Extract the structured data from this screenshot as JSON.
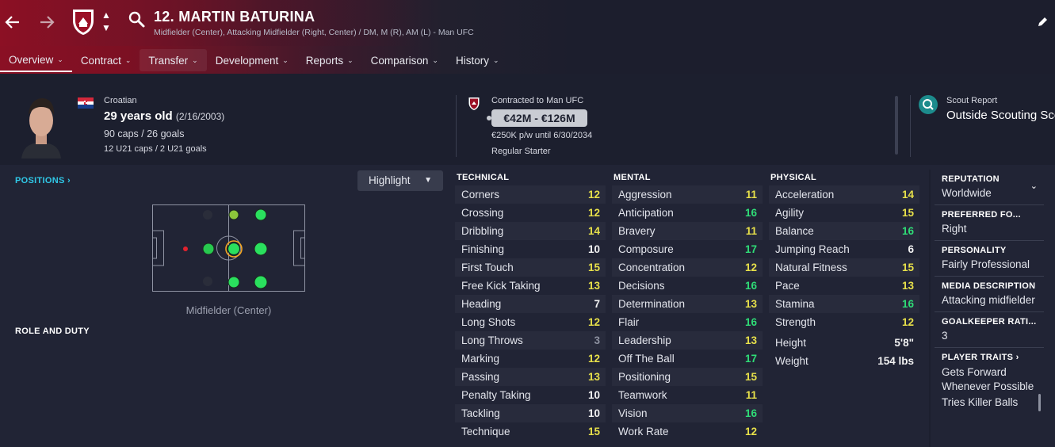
{
  "header": {
    "player_name": "12. MARTIN BATURINA",
    "positions_line": "Midfielder (Center), Attacking Midfielder (Right, Center) / DM, M (R), AM (L) - Man UFC",
    "back_icon": "arrow-left-icon",
    "forward_icon": "arrow-right-icon",
    "search_icon": "search-icon",
    "edit_icon": "pencil-icon",
    "brand_color": "#8a1024"
  },
  "tabs": [
    {
      "label": "Overview"
    },
    {
      "label": "Contract"
    },
    {
      "label": "Transfer"
    },
    {
      "label": "Development"
    },
    {
      "label": "Reports"
    },
    {
      "label": "Comparison"
    },
    {
      "label": "History"
    }
  ],
  "profile": {
    "nationality": "Croatian",
    "age": "29 years old",
    "dob": "(2/16/2003)",
    "caps": "90 caps / 26 goals",
    "u21": "12 U21 caps / 2 U21 goals"
  },
  "contract": {
    "contracted_to": "Contracted to Man UFC",
    "value": "€42M - €126M",
    "wage": "€250K p/w until 6/30/2034",
    "status": "Regular Starter"
  },
  "scout": {
    "label": "Scout Report",
    "value": "Outside Scouting Sco"
  },
  "positions_panel": {
    "title": "POSITIONS ›",
    "highlight_label": "Highlight",
    "pitch_label": "Midfielder (Center)",
    "role_title": "ROLE AND DUTY"
  },
  "attributes": {
    "technical": {
      "title": "TECHNICAL",
      "rows": [
        {
          "name": "Corners",
          "value": "12",
          "tone": "y"
        },
        {
          "name": "Crossing",
          "value": "12",
          "tone": "y"
        },
        {
          "name": "Dribbling",
          "value": "14",
          "tone": "y"
        },
        {
          "name": "Finishing",
          "value": "10",
          "tone": "w"
        },
        {
          "name": "First Touch",
          "value": "15",
          "tone": "y"
        },
        {
          "name": "Free Kick Taking",
          "value": "13",
          "tone": "y"
        },
        {
          "name": "Heading",
          "value": "7",
          "tone": "w"
        },
        {
          "name": "Long Shots",
          "value": "12",
          "tone": "y"
        },
        {
          "name": "Long Throws",
          "value": "3",
          "tone": "gr"
        },
        {
          "name": "Marking",
          "value": "12",
          "tone": "y"
        },
        {
          "name": "Passing",
          "value": "13",
          "tone": "y"
        },
        {
          "name": "Penalty Taking",
          "value": "10",
          "tone": "w"
        },
        {
          "name": "Tackling",
          "value": "10",
          "tone": "w"
        },
        {
          "name": "Technique",
          "value": "15",
          "tone": "y"
        }
      ]
    },
    "mental": {
      "title": "MENTAL",
      "rows": [
        {
          "name": "Aggression",
          "value": "11",
          "tone": "y"
        },
        {
          "name": "Anticipation",
          "value": "16",
          "tone": "g"
        },
        {
          "name": "Bravery",
          "value": "11",
          "tone": "y"
        },
        {
          "name": "Composure",
          "value": "17",
          "tone": "g"
        },
        {
          "name": "Concentration",
          "value": "12",
          "tone": "y"
        },
        {
          "name": "Decisions",
          "value": "16",
          "tone": "g"
        },
        {
          "name": "Determination",
          "value": "13",
          "tone": "y"
        },
        {
          "name": "Flair",
          "value": "16",
          "tone": "g"
        },
        {
          "name": "Leadership",
          "value": "13",
          "tone": "y"
        },
        {
          "name": "Off The Ball",
          "value": "17",
          "tone": "g"
        },
        {
          "name": "Positioning",
          "value": "15",
          "tone": "y"
        },
        {
          "name": "Teamwork",
          "value": "11",
          "tone": "y"
        },
        {
          "name": "Vision",
          "value": "16",
          "tone": "g"
        },
        {
          "name": "Work Rate",
          "value": "12",
          "tone": "y"
        }
      ]
    },
    "physical": {
      "title": "PHYSICAL",
      "rows": [
        {
          "name": "Acceleration",
          "value": "14",
          "tone": "y"
        },
        {
          "name": "Agility",
          "value": "15",
          "tone": "y"
        },
        {
          "name": "Balance",
          "value": "16",
          "tone": "g"
        },
        {
          "name": "Jumping Reach",
          "value": "6",
          "tone": "w"
        },
        {
          "name": "Natural Fitness",
          "value": "15",
          "tone": "y"
        },
        {
          "name": "Pace",
          "value": "13",
          "tone": "y"
        },
        {
          "name": "Stamina",
          "value": "16",
          "tone": "g"
        },
        {
          "name": "Strength",
          "value": "12",
          "tone": "y"
        }
      ],
      "height_label": "Height",
      "height": "5'8\"",
      "weight_label": "Weight",
      "weight": "154 lbs"
    }
  },
  "info": {
    "reputation_label": "REPUTATION",
    "reputation": "Worldwide",
    "foot_label": "PREFERRED FO...",
    "foot": "Right",
    "personality_label": "PERSONALITY",
    "personality": "Fairly Professional",
    "media_label": "MEDIA DESCRIPTION",
    "media": "Attacking midfielder",
    "gk_label": "GOALKEEPER RATI...",
    "gk": "3",
    "traits_label": "PLAYER TRAITS ›",
    "traits": [
      "Gets Forward Whenever Possible",
      "Tries Killer Balls"
    ]
  }
}
